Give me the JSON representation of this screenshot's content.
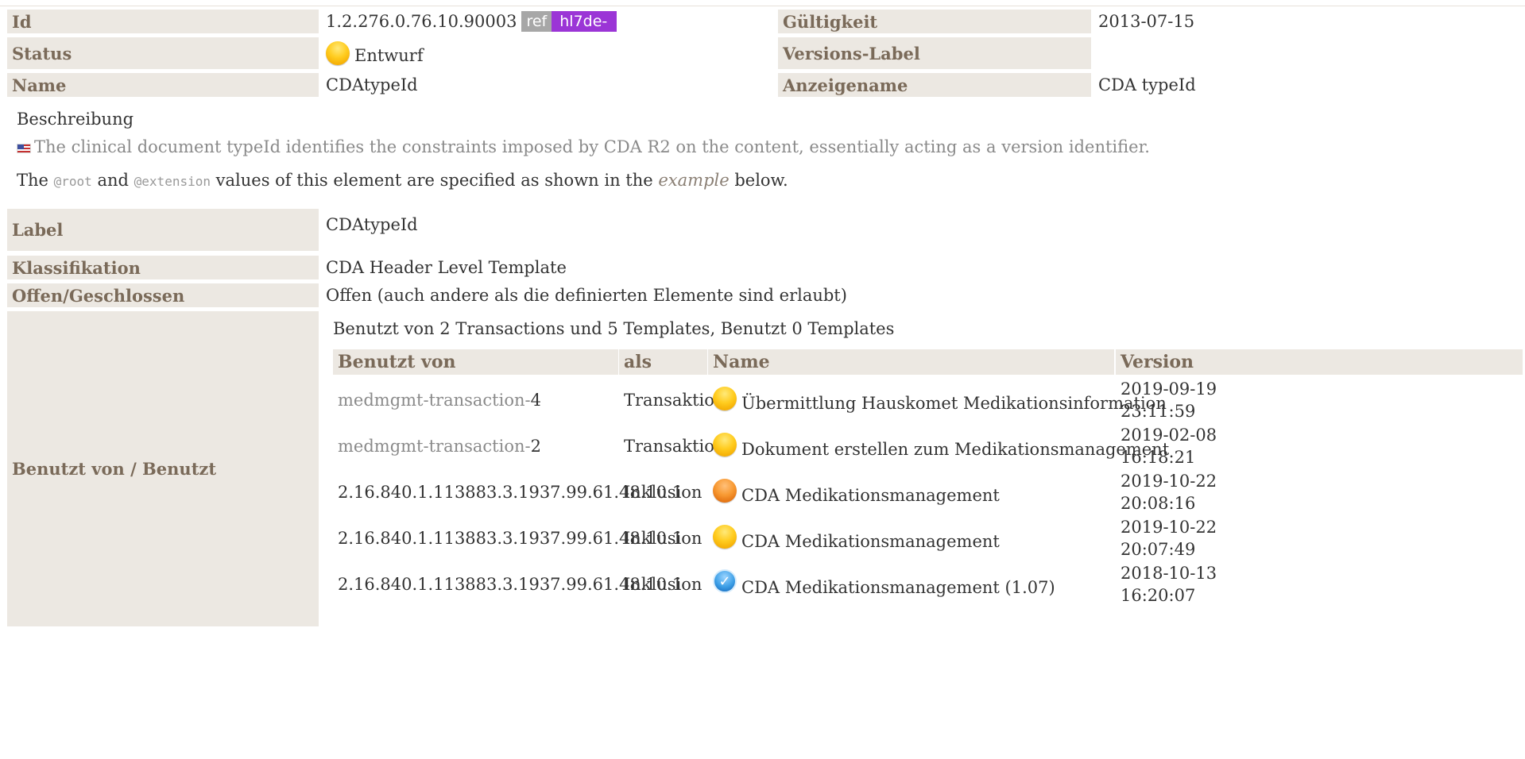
{
  "header": {
    "id_label": "Id",
    "id_value": "1.2.276.0.76.10.90003",
    "id_badge_ref": "ref",
    "id_badge_prefix": "hl7de-",
    "validity_label": "Gültigkeit",
    "validity_value": "2013-07-15",
    "status_label": "Status",
    "status_value": "Entwurf",
    "version_label_label": "Versions-Label",
    "version_label_value": "",
    "name_label": "Name",
    "name_value": "CDAtypeId",
    "display_name_label": "Anzeigename",
    "display_name_value": "CDA typeId"
  },
  "description": {
    "title": "Beschreibung",
    "english": "The clinical document typeId identifies the constraints imposed by CDA R2 on the content, essentially acting as a version identifier.",
    "line2_pre": "The ",
    "line2_root": "@root",
    "line2_and": " and ",
    "line2_ext": "@extension",
    "line2_mid": " values of this element are specified as shown in the ",
    "line2_example": "example",
    "line2_post": " below."
  },
  "details": {
    "label_label": "Label",
    "label_value": "CDAtypeId",
    "classification_label": "Klassifikation",
    "classification_value": "CDA Header Level Template",
    "open_closed_label": "Offen/Geschlossen",
    "open_closed_value": "Offen (auch andere als die definierten Elemente sind erlaubt)",
    "used_by_label": "Benutzt von / Benutzt",
    "used_by_summary": "Benutzt von 2 Transactions und 5 Templates, Benutzt 0 Templates"
  },
  "usage_table": {
    "columns": [
      "Benutzt von",
      "als",
      "Name",
      "Version"
    ],
    "rows": [
      {
        "used_by_prefix": "medmgmt-transaction-",
        "used_by_suffix": "4",
        "as": "Transaktion",
        "status_icon": "status-draft-yellow-icon",
        "name": "Übermittlung Hauskomet Medikationsinformation",
        "version_date": "2019-09-19",
        "version_time": "23:11:59"
      },
      {
        "used_by_prefix": "medmgmt-transaction-",
        "used_by_suffix": "2",
        "as": "Transaktion",
        "status_icon": "status-draft-yellow-icon",
        "name": "Dokument erstellen zum Medikationsmanagement",
        "version_date": "2019-02-08",
        "version_time": "16:18:21"
      },
      {
        "used_by_prefix": "2.16.840.1.113883.3.1937.99.61.48.10.1",
        "used_by_suffix": "",
        "as": "Inklusion",
        "status_icon": "status-pending-orange-icon",
        "name": "CDA Medikationsmanagement",
        "version_date": "2019-10-22",
        "version_time": "20:08:16"
      },
      {
        "used_by_prefix": "2.16.840.1.113883.3.1937.99.61.48.10.1",
        "used_by_suffix": "",
        "as": "Inklusion",
        "status_icon": "status-draft-yellow-icon",
        "name": "CDA Medikationsmanagement",
        "version_date": "2019-10-22",
        "version_time": "20:07:49"
      },
      {
        "used_by_prefix": "2.16.840.1.113883.3.1937.99.61.48.10.1",
        "used_by_suffix": "",
        "as": "Inklusion",
        "status_icon": "status-active-blue-check-icon",
        "name": "CDA Medikationsmanagement (1.07)",
        "version_date": "2018-10-13",
        "version_time": "16:20:07"
      }
    ]
  },
  "colors": {
    "label_background": "#ece8e2",
    "label_text": "#7a6a59",
    "badge_ref": "#a7a7a7",
    "badge_prefix": "#9b35d6"
  }
}
